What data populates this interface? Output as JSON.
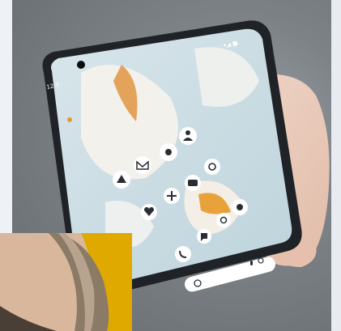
{
  "scene": {
    "description_free": true,
    "status_time": "12:3",
    "status_right": "⋅⋅ ▾◢ ■",
    "app_labels": [
      "",
      "",
      "",
      "",
      "",
      ""
    ],
    "colors": {
      "phone_body": "#1f2226",
      "screen_bg": "#cfe0e6",
      "petal_light": "#f3f1ec",
      "petal_orange": "#e8a23a",
      "icon_bg": "#ffffff",
      "icon_fg": "#2a2e33",
      "inset_yellow": "#e0a900",
      "hair": "#8a7a66"
    }
  }
}
